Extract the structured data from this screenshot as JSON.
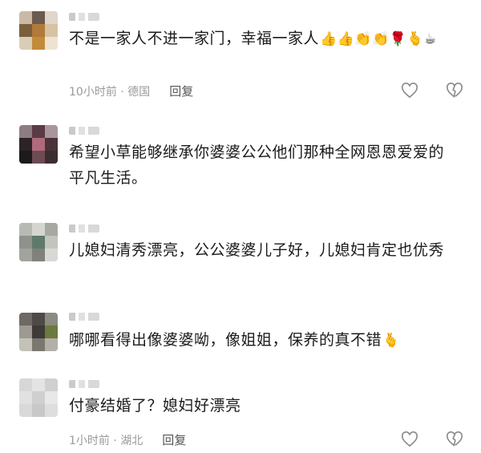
{
  "comments": [
    {
      "text": "不是一家人不进一家门，幸福一家人",
      "emojis": "👍👍👏👏🌹🫰☕",
      "time": "10小时前",
      "location": "德国",
      "reply": "回复"
    },
    {
      "text": "希望小草能够继承你婆婆公公他们那种全网恩恩爱爱的 平凡生活。"
    },
    {
      "text": "儿媳妇清秀漂亮，公公婆婆儿子好，儿媳妇肯定也优秀"
    },
    {
      "text": "哪哪看得出像婆婆呦，像姐姐，保养的真不错",
      "emojis": "🫰"
    },
    {
      "text": "付豪结婚了？媳妇好漂亮",
      "time": "1小时前",
      "location": "湖北",
      "reply": "回复"
    }
  ],
  "separator": " · ",
  "icons": {
    "like": "heart-icon",
    "dislike": "broken-heart-icon"
  },
  "colors": {
    "text": "#1b1b1b",
    "meta": "#9a9a9a",
    "icon": "#8a8a8a"
  }
}
